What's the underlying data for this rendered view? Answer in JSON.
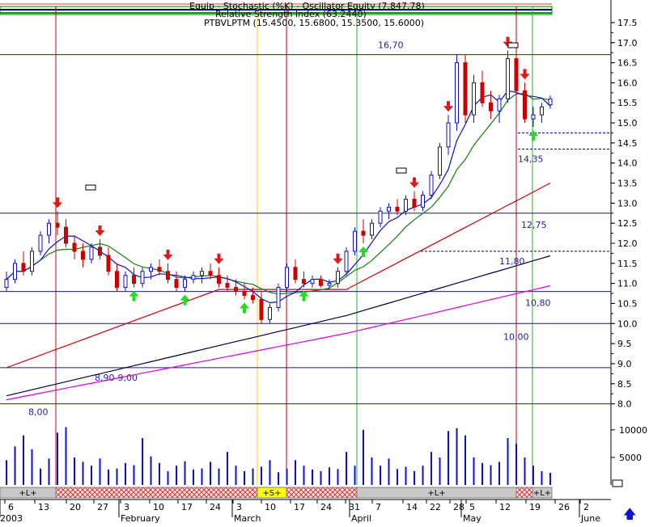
{
  "header": {
    "line1": "Equip - Stochastic (%K) - Oscillator Equity (7.847.78)",
    "line2": "Relative Strength Index (63.2440)",
    "line3": "PTBVLPTM (15.4500, 15.6800, 15.3500, 15.6000)"
  },
  "colors": {
    "up_arrow": "#22dd22",
    "down_arrow": "#e01818",
    "level_line": "#1a1a8c",
    "vertical_red": "#c00000",
    "vertical_yellow": "#ffd000",
    "vertical_green": "#22bb22",
    "ma_short": "#1010c0",
    "ma_mid": "#108010",
    "ma_long": "#d00000",
    "ma_longer": "#000040",
    "ma_magenta": "#e000e0",
    "volume": "#1010d0",
    "status_gray": "#c8c8c8",
    "status_hatch": "#e03030",
    "status_yellow": "#ffff00"
  },
  "chart_data": {
    "type": "candlestick",
    "title": "PTBVLPTM (15.4500, 15.6800, 15.3500, 15.6000)",
    "ylim": [
      7.75,
      17.7
    ],
    "y_ticks": [
      8.0,
      8.5,
      9.0,
      9.5,
      10.0,
      10.5,
      11.0,
      11.5,
      12.0,
      12.5,
      13.0,
      13.5,
      14.0,
      14.5,
      15.0,
      15.5,
      16.0,
      16.5,
      17.0,
      17.5
    ],
    "volume_ticks": [
      "5000",
      "10000"
    ],
    "x_tick_labels": [
      "6",
      "13",
      "20",
      "27",
      "3",
      "10",
      "17",
      "24",
      "3",
      "10",
      "17",
      "24",
      "31",
      "7",
      "14",
      "22",
      "28",
      "5",
      "12",
      "19",
      "26",
      "2"
    ],
    "month_labels": [
      "2003",
      "February",
      "March",
      "April",
      "May",
      "June"
    ],
    "price_levels": [
      {
        "value": 16.7,
        "label": "16,70"
      },
      {
        "value": 12.75,
        "label": "12,75"
      },
      {
        "value": 10.8,
        "label": "10,80"
      },
      {
        "value": 10.0,
        "label": "10,00"
      },
      {
        "value": 8.9,
        "label": "8,90-9,00"
      },
      {
        "value": 8.0,
        "label": "8,00"
      }
    ],
    "dashed_levels": [
      {
        "value": 14.75,
        "label": ""
      },
      {
        "value": 14.35,
        "label": "14,35"
      },
      {
        "value": 11.8,
        "label": "11,80"
      }
    ],
    "vertical_markers": [
      {
        "week": "13 Jan",
        "color": "red"
      },
      {
        "week": "10 Mar",
        "color": "yellow"
      },
      {
        "week": "17 Mar",
        "color": "red"
      },
      {
        "week": "31 Mar",
        "color": "green"
      },
      {
        "week": "12 May",
        "color": "red"
      },
      {
        "week": "19 May",
        "color": "green"
      }
    ],
    "status_bar": [
      {
        "label": "+L+",
        "style": "gray"
      },
      {
        "label": "",
        "style": "hatch"
      },
      {
        "label": "+S+",
        "style": "yellow"
      },
      {
        "label": "",
        "style": "hatch"
      },
      {
        "label": "+L+",
        "style": "gray"
      },
      {
        "label": "",
        "style": "hatch"
      },
      {
        "label": "+L+",
        "style": "gray"
      }
    ],
    "candles": [
      [
        10.9,
        11.3,
        10.8,
        11.1
      ],
      [
        11.1,
        11.6,
        11.0,
        11.5
      ],
      [
        11.5,
        11.8,
        11.2,
        11.3
      ],
      [
        11.3,
        11.9,
        11.2,
        11.8
      ],
      [
        11.8,
        12.3,
        11.7,
        12.2
      ],
      [
        12.2,
        12.6,
        12.0,
        12.5
      ],
      [
        12.5,
        12.8,
        12.2,
        12.4
      ],
      [
        12.4,
        12.6,
        11.9,
        12.0
      ],
      [
        12.0,
        12.2,
        11.6,
        11.8
      ],
      [
        11.8,
        12.0,
        11.4,
        11.6
      ],
      [
        11.6,
        12.0,
        11.5,
        11.9
      ],
      [
        11.9,
        12.1,
        11.6,
        11.7
      ],
      [
        11.7,
        11.9,
        11.2,
        11.3
      ],
      [
        11.3,
        11.5,
        10.8,
        10.9
      ],
      [
        10.9,
        11.3,
        10.8,
        11.2
      ],
      [
        11.2,
        11.4,
        10.9,
        11.0
      ],
      [
        11.0,
        11.4,
        10.9,
        11.3
      ],
      [
        11.3,
        11.5,
        11.1,
        11.4
      ],
      [
        11.4,
        11.6,
        11.2,
        11.3
      ],
      [
        11.3,
        11.5,
        11.0,
        11.1
      ],
      [
        11.1,
        11.3,
        10.8,
        10.9
      ],
      [
        10.9,
        11.2,
        10.8,
        11.1
      ],
      [
        11.1,
        11.3,
        11.0,
        11.2
      ],
      [
        11.2,
        11.4,
        11.0,
        11.3
      ],
      [
        11.3,
        11.5,
        11.1,
        11.2
      ],
      [
        11.2,
        11.4,
        10.9,
        11.0
      ],
      [
        11.0,
        11.2,
        10.8,
        10.9
      ],
      [
        10.9,
        11.1,
        10.7,
        10.8
      ],
      [
        10.8,
        11.0,
        10.6,
        10.7
      ],
      [
        10.7,
        10.9,
        10.5,
        10.6
      ],
      [
        10.6,
        10.8,
        10.0,
        10.1
      ],
      [
        10.1,
        10.5,
        10.0,
        10.4
      ],
      [
        10.4,
        11.0,
        10.3,
        10.9
      ],
      [
        10.9,
        11.5,
        10.8,
        11.4
      ],
      [
        11.4,
        11.6,
        11.0,
        11.1
      ],
      [
        11.1,
        11.3,
        10.9,
        11.0
      ],
      [
        11.0,
        11.2,
        10.9,
        11.1
      ],
      [
        11.1,
        11.2,
        10.9,
        10.95
      ],
      [
        10.95,
        11.1,
        10.85,
        11.0
      ],
      [
        11.0,
        11.4,
        10.9,
        11.3
      ],
      [
        11.3,
        11.9,
        11.2,
        11.8
      ],
      [
        11.8,
        12.4,
        11.7,
        12.3
      ],
      [
        12.3,
        12.6,
        12.0,
        12.2
      ],
      [
        12.2,
        12.6,
        12.1,
        12.5
      ],
      [
        12.5,
        12.9,
        12.4,
        12.8
      ],
      [
        12.8,
        13.0,
        12.6,
        12.9
      ],
      [
        12.9,
        13.1,
        12.7,
        12.8
      ],
      [
        12.8,
        13.2,
        12.7,
        13.1
      ],
      [
        13.1,
        13.3,
        12.8,
        12.9
      ],
      [
        12.9,
        13.3,
        12.8,
        13.2
      ],
      [
        13.2,
        13.8,
        13.1,
        13.7
      ],
      [
        13.7,
        14.5,
        13.6,
        14.4
      ],
      [
        14.4,
        15.2,
        14.2,
        15.0
      ],
      [
        15.0,
        16.7,
        14.8,
        16.5
      ],
      [
        16.5,
        16.7,
        15.0,
        15.2
      ],
      [
        15.2,
        16.2,
        15.0,
        16.0
      ],
      [
        16.0,
        16.3,
        15.4,
        15.5
      ],
      [
        15.5,
        15.8,
        15.1,
        15.3
      ],
      [
        15.3,
        15.7,
        15.0,
        15.6
      ],
      [
        15.6,
        16.8,
        15.5,
        16.6
      ],
      [
        16.6,
        16.9,
        15.6,
        15.8
      ],
      [
        15.8,
        16.0,
        15.0,
        15.1
      ],
      [
        15.1,
        15.4,
        14.9,
        15.2
      ],
      [
        15.2,
        15.5,
        15.0,
        15.4
      ],
      [
        15.45,
        15.68,
        15.35,
        15.6
      ]
    ],
    "volume": [
      4500,
      7000,
      9000,
      6500,
      3000,
      4800,
      9500,
      10500,
      5000,
      4200,
      3500,
      4800,
      2800,
      3000,
      4000,
      3600,
      8500,
      5200,
      4000,
      2500,
      3500,
      4300,
      2800,
      3000,
      4200,
      3000,
      6000,
      3500,
      2500,
      3000,
      3300,
      4500,
      2300,
      3000,
      4500,
      3500,
      2800,
      2500,
      3200,
      2900,
      6000,
      3500,
      10000,
      5000,
      3500,
      4800,
      2900,
      3300,
      2500,
      3500,
      6000,
      5000,
      9800,
      10300,
      9000,
      5000,
      4000,
      3600,
      4200,
      8500,
      7500,
      5000,
      3500,
      2500,
      2200
    ]
  }
}
